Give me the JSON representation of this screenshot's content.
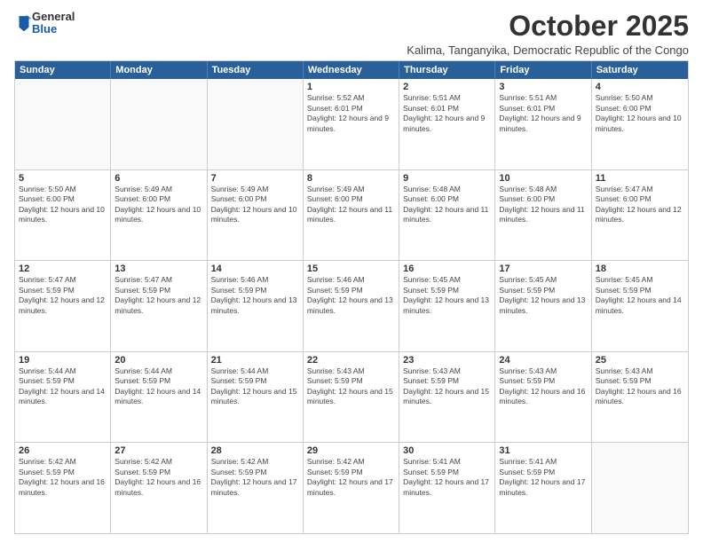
{
  "logo": {
    "general": "General",
    "blue": "Blue"
  },
  "header": {
    "month": "October 2025",
    "location": "Kalima, Tanganyika, Democratic Republic of the Congo"
  },
  "weekdays": [
    "Sunday",
    "Monday",
    "Tuesday",
    "Wednesday",
    "Thursday",
    "Friday",
    "Saturday"
  ],
  "rows": [
    [
      {
        "day": "",
        "text": "",
        "empty": true
      },
      {
        "day": "",
        "text": "",
        "empty": true
      },
      {
        "day": "",
        "text": "",
        "empty": true
      },
      {
        "day": "1",
        "text": "Sunrise: 5:52 AM\nSunset: 6:01 PM\nDaylight: 12 hours and 9 minutes.",
        "empty": false
      },
      {
        "day": "2",
        "text": "Sunrise: 5:51 AM\nSunset: 6:01 PM\nDaylight: 12 hours and 9 minutes.",
        "empty": false
      },
      {
        "day": "3",
        "text": "Sunrise: 5:51 AM\nSunset: 6:01 PM\nDaylight: 12 hours and 9 minutes.",
        "empty": false
      },
      {
        "day": "4",
        "text": "Sunrise: 5:50 AM\nSunset: 6:00 PM\nDaylight: 12 hours and 10 minutes.",
        "empty": false
      }
    ],
    [
      {
        "day": "5",
        "text": "Sunrise: 5:50 AM\nSunset: 6:00 PM\nDaylight: 12 hours and 10 minutes.",
        "empty": false
      },
      {
        "day": "6",
        "text": "Sunrise: 5:49 AM\nSunset: 6:00 PM\nDaylight: 12 hours and 10 minutes.",
        "empty": false
      },
      {
        "day": "7",
        "text": "Sunrise: 5:49 AM\nSunset: 6:00 PM\nDaylight: 12 hours and 10 minutes.",
        "empty": false
      },
      {
        "day": "8",
        "text": "Sunrise: 5:49 AM\nSunset: 6:00 PM\nDaylight: 12 hours and 11 minutes.",
        "empty": false
      },
      {
        "day": "9",
        "text": "Sunrise: 5:48 AM\nSunset: 6:00 PM\nDaylight: 12 hours and 11 minutes.",
        "empty": false
      },
      {
        "day": "10",
        "text": "Sunrise: 5:48 AM\nSunset: 6:00 PM\nDaylight: 12 hours and 11 minutes.",
        "empty": false
      },
      {
        "day": "11",
        "text": "Sunrise: 5:47 AM\nSunset: 6:00 PM\nDaylight: 12 hours and 12 minutes.",
        "empty": false
      }
    ],
    [
      {
        "day": "12",
        "text": "Sunrise: 5:47 AM\nSunset: 5:59 PM\nDaylight: 12 hours and 12 minutes.",
        "empty": false
      },
      {
        "day": "13",
        "text": "Sunrise: 5:47 AM\nSunset: 5:59 PM\nDaylight: 12 hours and 12 minutes.",
        "empty": false
      },
      {
        "day": "14",
        "text": "Sunrise: 5:46 AM\nSunset: 5:59 PM\nDaylight: 12 hours and 13 minutes.",
        "empty": false
      },
      {
        "day": "15",
        "text": "Sunrise: 5:46 AM\nSunset: 5:59 PM\nDaylight: 12 hours and 13 minutes.",
        "empty": false
      },
      {
        "day": "16",
        "text": "Sunrise: 5:45 AM\nSunset: 5:59 PM\nDaylight: 12 hours and 13 minutes.",
        "empty": false
      },
      {
        "day": "17",
        "text": "Sunrise: 5:45 AM\nSunset: 5:59 PM\nDaylight: 12 hours and 13 minutes.",
        "empty": false
      },
      {
        "day": "18",
        "text": "Sunrise: 5:45 AM\nSunset: 5:59 PM\nDaylight: 12 hours and 14 minutes.",
        "empty": false
      }
    ],
    [
      {
        "day": "19",
        "text": "Sunrise: 5:44 AM\nSunset: 5:59 PM\nDaylight: 12 hours and 14 minutes.",
        "empty": false
      },
      {
        "day": "20",
        "text": "Sunrise: 5:44 AM\nSunset: 5:59 PM\nDaylight: 12 hours and 14 minutes.",
        "empty": false
      },
      {
        "day": "21",
        "text": "Sunrise: 5:44 AM\nSunset: 5:59 PM\nDaylight: 12 hours and 15 minutes.",
        "empty": false
      },
      {
        "day": "22",
        "text": "Sunrise: 5:43 AM\nSunset: 5:59 PM\nDaylight: 12 hours and 15 minutes.",
        "empty": false
      },
      {
        "day": "23",
        "text": "Sunrise: 5:43 AM\nSunset: 5:59 PM\nDaylight: 12 hours and 15 minutes.",
        "empty": false
      },
      {
        "day": "24",
        "text": "Sunrise: 5:43 AM\nSunset: 5:59 PM\nDaylight: 12 hours and 16 minutes.",
        "empty": false
      },
      {
        "day": "25",
        "text": "Sunrise: 5:43 AM\nSunset: 5:59 PM\nDaylight: 12 hours and 16 minutes.",
        "empty": false
      }
    ],
    [
      {
        "day": "26",
        "text": "Sunrise: 5:42 AM\nSunset: 5:59 PM\nDaylight: 12 hours and 16 minutes.",
        "empty": false
      },
      {
        "day": "27",
        "text": "Sunrise: 5:42 AM\nSunset: 5:59 PM\nDaylight: 12 hours and 16 minutes.",
        "empty": false
      },
      {
        "day": "28",
        "text": "Sunrise: 5:42 AM\nSunset: 5:59 PM\nDaylight: 12 hours and 17 minutes.",
        "empty": false
      },
      {
        "day": "29",
        "text": "Sunrise: 5:42 AM\nSunset: 5:59 PM\nDaylight: 12 hours and 17 minutes.",
        "empty": false
      },
      {
        "day": "30",
        "text": "Sunrise: 5:41 AM\nSunset: 5:59 PM\nDaylight: 12 hours and 17 minutes.",
        "empty": false
      },
      {
        "day": "31",
        "text": "Sunrise: 5:41 AM\nSunset: 5:59 PM\nDaylight: 12 hours and 17 minutes.",
        "empty": false
      },
      {
        "day": "",
        "text": "",
        "empty": true
      }
    ]
  ]
}
